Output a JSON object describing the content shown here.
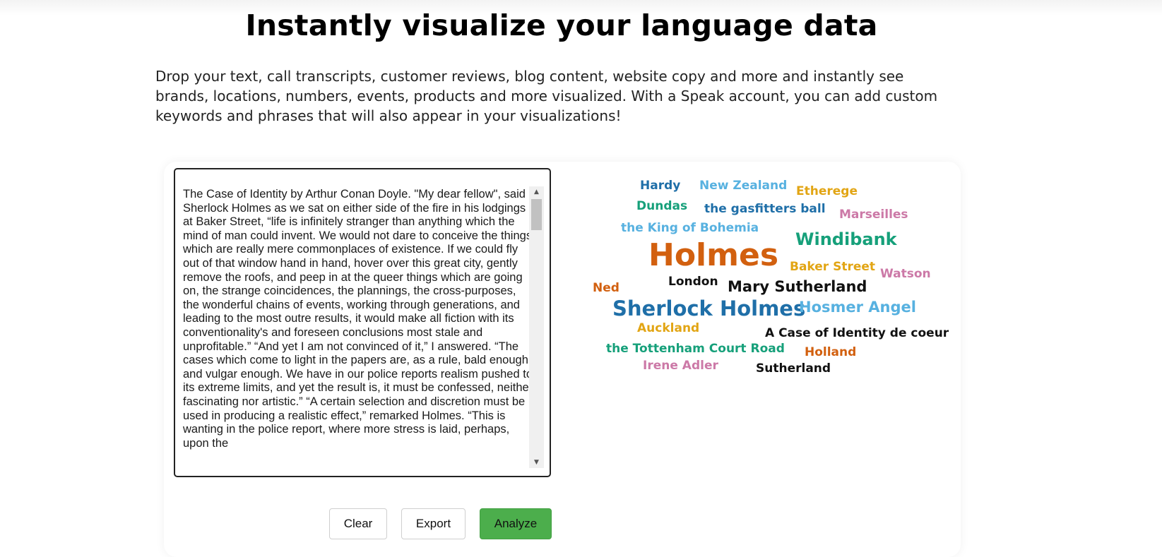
{
  "headline": "Instantly visualize your language data",
  "intro": "Drop your text, call transcripts, customer reviews, blog content, website copy and more and instantly see brands, locations, numbers, events, products and more visualized. With a Speak account, you can add custom keywords and phrases that will also appear in your visualizations!",
  "input_text": "The Case of Identity by Arthur Conan Doyle. \"My dear fellow\", said Sherlock Holmes as we sat on either side of the fire in his lodgings at Baker Street, “life is infinitely stranger than anything which the mind of man could invent. We would not dare to conceive the things which are really mere commonplaces of existence. If we could fly out of that window hand in hand, hover over this great city, gently remove the roofs, and peep in at the queer things which are going on, the strange coincidences, the plannings, the cross-purposes, the wonderful chains of events, working through generations, and leading to the most outre results, it would make all fiction with its conventionality's and foreseen conclusions most stale and unprofitable.” “And yet I am not convinced of it,” I answered. “The cases which come to light in the papers are, as a rule, bald enough, and vulgar enough. We have in our police reports realism pushed to its extreme limits, and yet the result is, it must be confessed, neither fascinating nor artistic.” “A certain selection and discretion must be used in producing a realistic effect,” remarked Holmes. “This is wanting in the police report, where more stress is laid, perhaps, upon the",
  "buttons": {
    "clear": "Clear",
    "export": "Export",
    "analyze": "Analyze"
  },
  "icons": {
    "scroll_up": "triangle-up",
    "scroll_down": "triangle-down"
  },
  "colors": {
    "dark_blue": "#1f6fa8",
    "light_blue": "#57b1e0",
    "gold": "#e2a514",
    "pink": "#cc79a7",
    "green": "#16a07a",
    "orange": "#d2600f",
    "black": "#111111",
    "analyze_button": "#4cae4c"
  },
  "word_cloud": [
    {
      "text": "Hardy",
      "color": "dark_blue"
    },
    {
      "text": "New Zealand",
      "color": "light_blue"
    },
    {
      "text": "Etherege",
      "color": "gold"
    },
    {
      "text": "Dundas",
      "color": "green"
    },
    {
      "text": "the gasfitters ball",
      "color": "dark_blue"
    },
    {
      "text": "Marseilles",
      "color": "pink"
    },
    {
      "text": "the King of Bohemia",
      "color": "light_blue"
    },
    {
      "text": "Windibank",
      "color": "green"
    },
    {
      "text": "Holmes",
      "color": "orange"
    },
    {
      "text": "Baker Street",
      "color": "gold"
    },
    {
      "text": "Watson",
      "color": "pink"
    },
    {
      "text": "Ned",
      "color": "orange"
    },
    {
      "text": "London",
      "color": "black"
    },
    {
      "text": "Mary Sutherland",
      "color": "black"
    },
    {
      "text": "Sherlock Holmes",
      "color": "dark_blue"
    },
    {
      "text": "Hosmer Angel",
      "color": "light_blue"
    },
    {
      "text": "Auckland",
      "color": "gold"
    },
    {
      "text": "A Case of Identity de coeur",
      "color": "black"
    },
    {
      "text": "the Tottenham Court Road",
      "color": "green"
    },
    {
      "text": "Holland",
      "color": "orange"
    },
    {
      "text": "Irene Adler",
      "color": "pink"
    },
    {
      "text": "Sutherland",
      "color": "black"
    }
  ]
}
